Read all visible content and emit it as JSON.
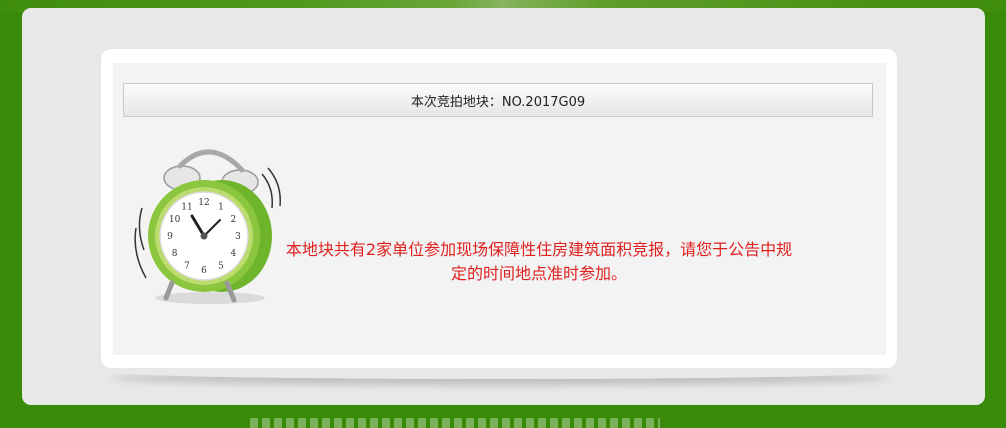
{
  "auction": {
    "title": "本次竞拍地块：NO.2017G09",
    "message": "本地块共有2家单位参加现场保障性住房建筑面积竞报，请您于公告中规定的时间地点准时参加。"
  },
  "clock": {
    "numerals": [
      "12",
      "1",
      "2",
      "3",
      "4",
      "5",
      "6",
      "7",
      "8",
      "9",
      "10",
      "11"
    ]
  },
  "colors": {
    "background_green": "#3a8a0a",
    "message_red": "#e01f1f",
    "clock_green": "#8cc63f"
  },
  "icons": [
    "alarm-clock-icon"
  ]
}
